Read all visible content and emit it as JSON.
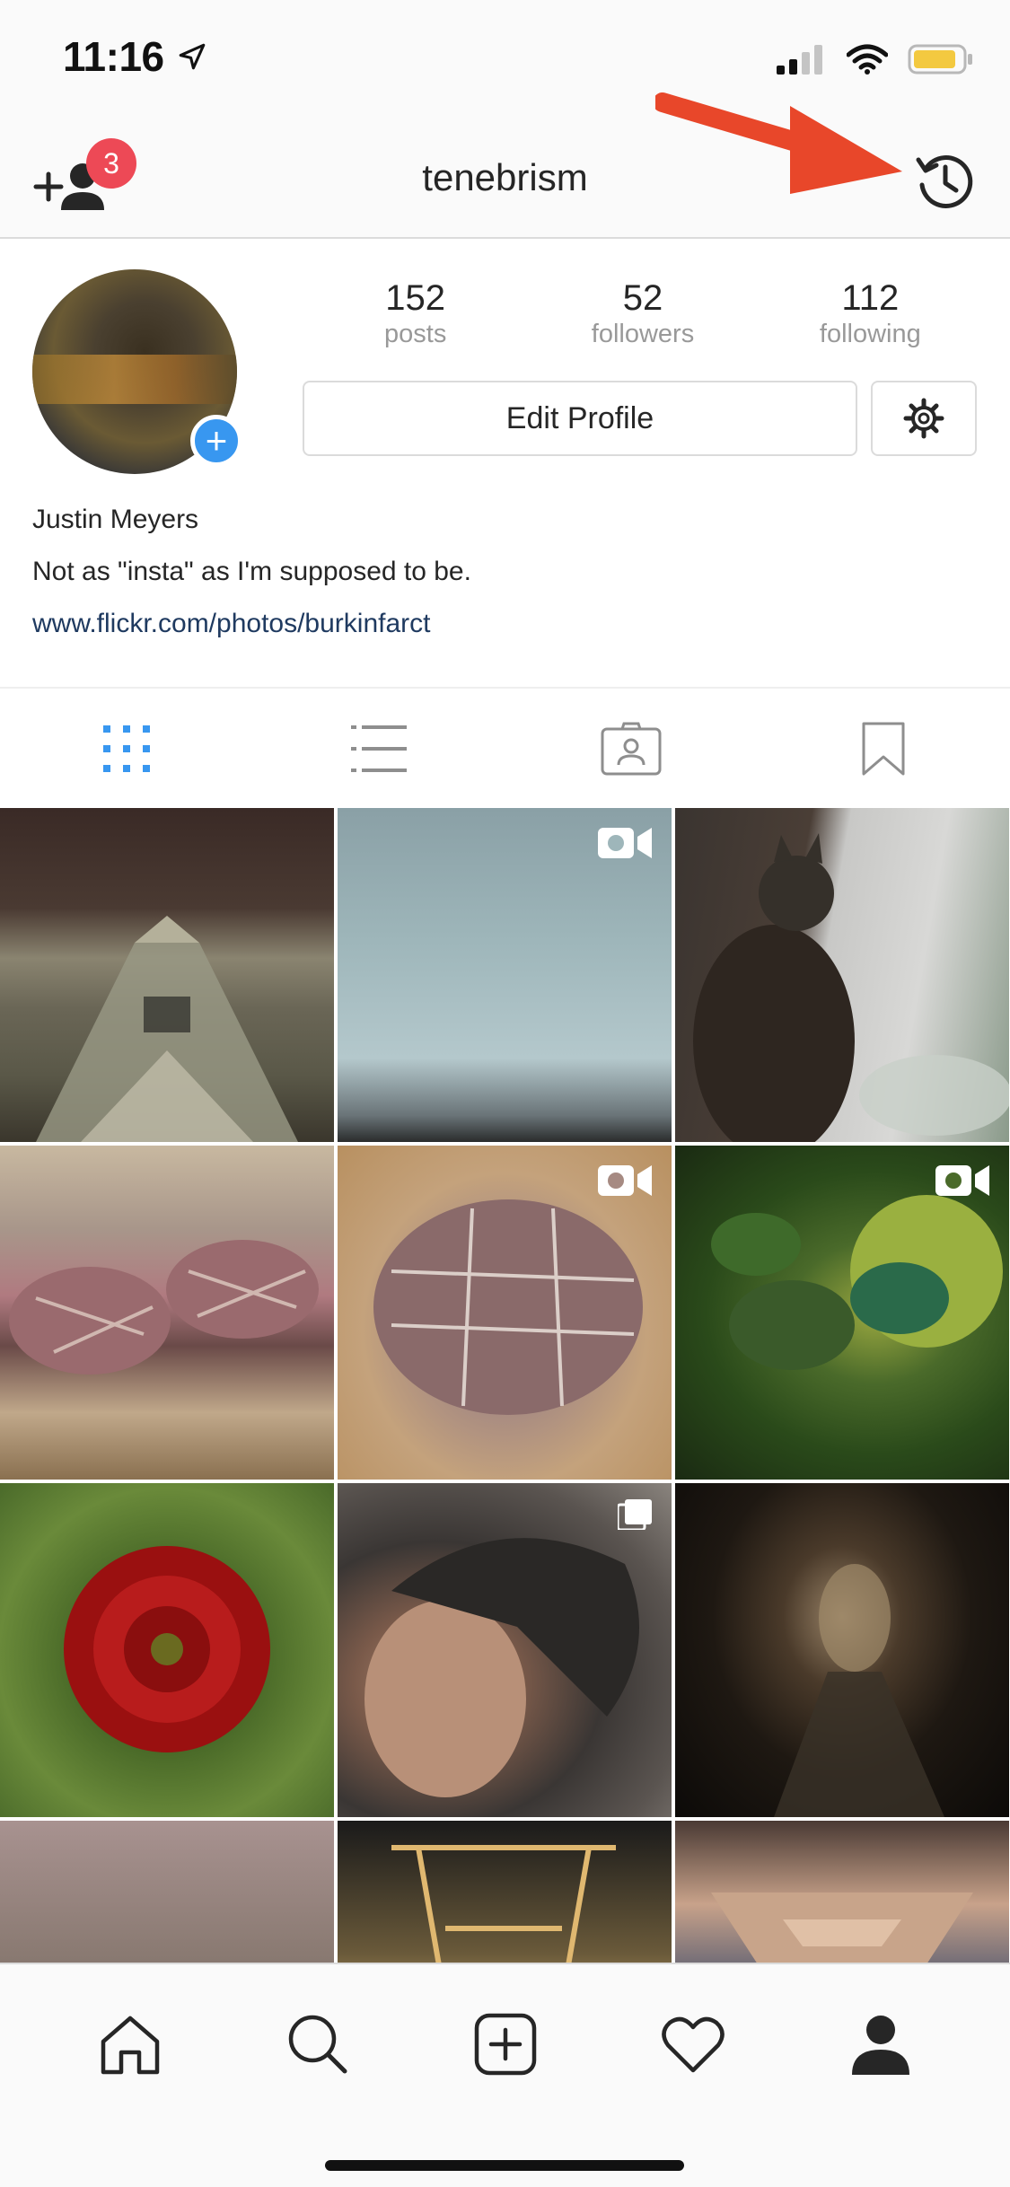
{
  "status_bar": {
    "time": "11:16",
    "icons": [
      "location-arrow-icon",
      "cellular-signal-icon",
      "wifi-icon",
      "battery-icon"
    ]
  },
  "header": {
    "username": "tenebrism",
    "notification_count": "3",
    "left_icon": "add-person-icon",
    "right_icon": "archive-clock-icon",
    "annotation": "red-arrow-pointing-to-archive"
  },
  "profile": {
    "stats": [
      {
        "value": "152",
        "label": "posts"
      },
      {
        "value": "52",
        "label": "followers"
      },
      {
        "value": "112",
        "label": "following"
      }
    ],
    "edit_profile_label": "Edit Profile",
    "full_name": "Justin Meyers",
    "bio": "Not as \"insta\" as I'm supposed to be.",
    "website": "www.flickr.com/photos/burkinfarct"
  },
  "tabs": [
    {
      "icon": "grid-icon",
      "active": true
    },
    {
      "icon": "list-icon",
      "active": false
    },
    {
      "icon": "tagged-icon",
      "active": false
    },
    {
      "icon": "bookmark-icon",
      "active": false
    }
  ],
  "posts": [
    {
      "subject": "church tower",
      "badge": ""
    },
    {
      "subject": "snowy window",
      "badge": "video"
    },
    {
      "subject": "cat at window",
      "badge": ""
    },
    {
      "subject": "wrapped roasts",
      "badge": ""
    },
    {
      "subject": "tied roast",
      "badge": "video"
    },
    {
      "subject": "beetles on fig",
      "badge": "video"
    },
    {
      "subject": "red dahlia",
      "badge": ""
    },
    {
      "subject": "mannequin head",
      "badge": "multiple"
    },
    {
      "subject": "tunnel",
      "badge": ""
    },
    {
      "subject": "rocky shore",
      "badge": ""
    },
    {
      "subject": "lit bridge",
      "badge": ""
    },
    {
      "subject": "pavilion ceiling",
      "badge": ""
    }
  ],
  "colors": {
    "accent": "#3897f0",
    "badge": "#ed4956",
    "arrow": "#e8472a",
    "link": "#1f3a60"
  },
  "bottom_nav": [
    "home-icon",
    "search-icon",
    "new-post-icon",
    "activity-heart-icon",
    "profile-icon"
  ]
}
